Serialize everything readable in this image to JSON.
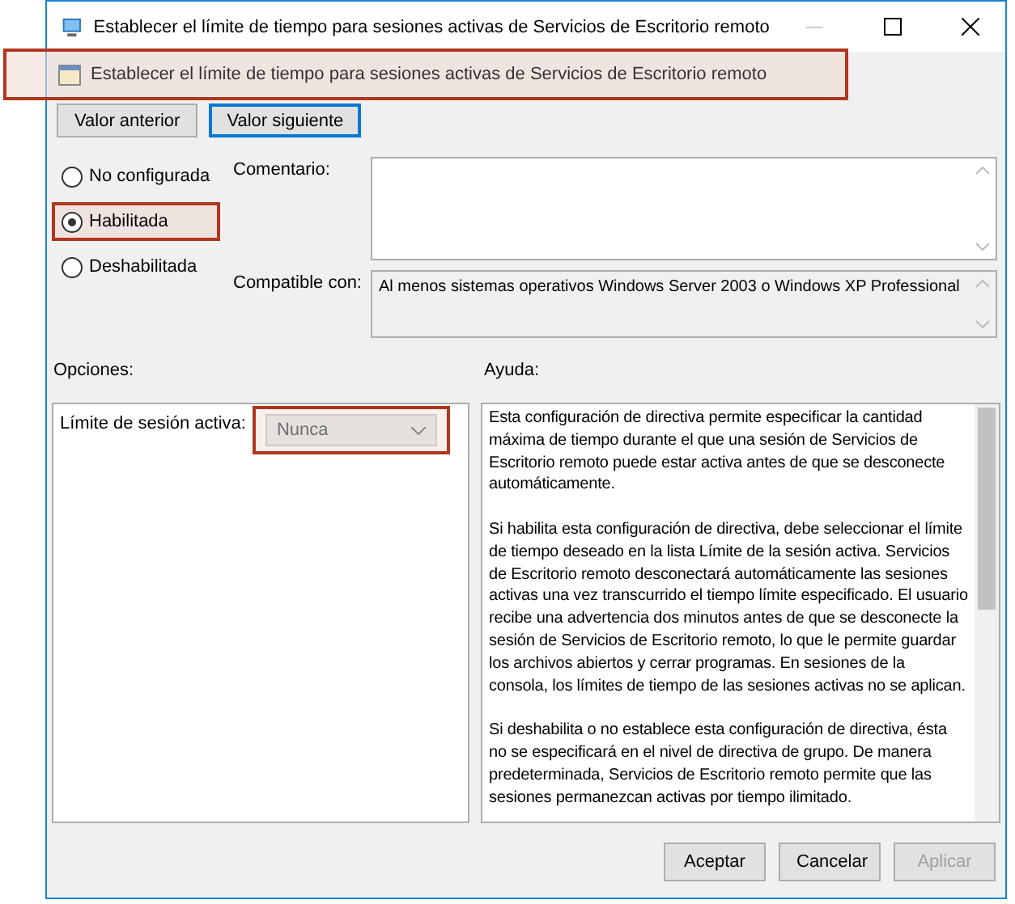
{
  "window": {
    "title": "Establecer el límite de tiempo para sesiones activas de Servicios de Escritorio remoto"
  },
  "header": {
    "text": "Establecer el límite de tiempo para sesiones activas de Servicios de Escritorio remoto",
    "highlighted": true
  },
  "nav_buttons": [
    {
      "label": "Valor anterior",
      "focused": false
    },
    {
      "label": "Valor siguiente",
      "focused": true
    }
  ],
  "states": [
    {
      "label": "No configurada",
      "selected": false,
      "highlighted": false
    },
    {
      "label": "Habilitada",
      "selected": true,
      "highlighted": true
    },
    {
      "label": "Deshabilitada",
      "selected": false,
      "highlighted": false
    }
  ],
  "comment": {
    "label": "Comentario:"
  },
  "compatible": {
    "label": "Compatible con:",
    "value": "Al menos sistemas operativos Windows Server 2003 o Windows XP Professional"
  },
  "options": {
    "label": "Opciones:",
    "field_label": "Límite de sesión activa:",
    "value": "Nunca",
    "disabled": true,
    "highlighted": true
  },
  "help": {
    "label": "Ayuda:",
    "paragraphs": [
      "Esta configuración de directiva permite especificar la cantidad máxima de tiempo durante el que una sesión de Servicios de Escritorio remoto puede estar activa antes de que se desconecte automáticamente.",
      "Si habilita esta configuración de directiva, debe seleccionar el límite de tiempo deseado en la lista Límite de la sesión activa. Servicios de Escritorio remoto desconectará automáticamente las sesiones activas una vez transcurrido el tiempo límite especificado. El usuario recibe una advertencia dos minutos antes de que se desconecte la sesión de Servicios de Escritorio remoto, lo que le permite guardar los archivos abiertos y cerrar programas. En sesiones de la consola, los límites de tiempo de las sesiones activas no se aplican.",
      "Si deshabilita o no establece esta configuración de directiva, ésta no se especificará en el nivel de directiva de grupo. De manera predeterminada, Servicios de Escritorio remoto permite que las sesiones permanezcan activas por tiempo ilimitado."
    ]
  },
  "footer_buttons": [
    {
      "label": "Aceptar",
      "disabled": false
    },
    {
      "label": "Cancelar",
      "disabled": false
    },
    {
      "label": "Aplicar",
      "disabled": true
    }
  ]
}
